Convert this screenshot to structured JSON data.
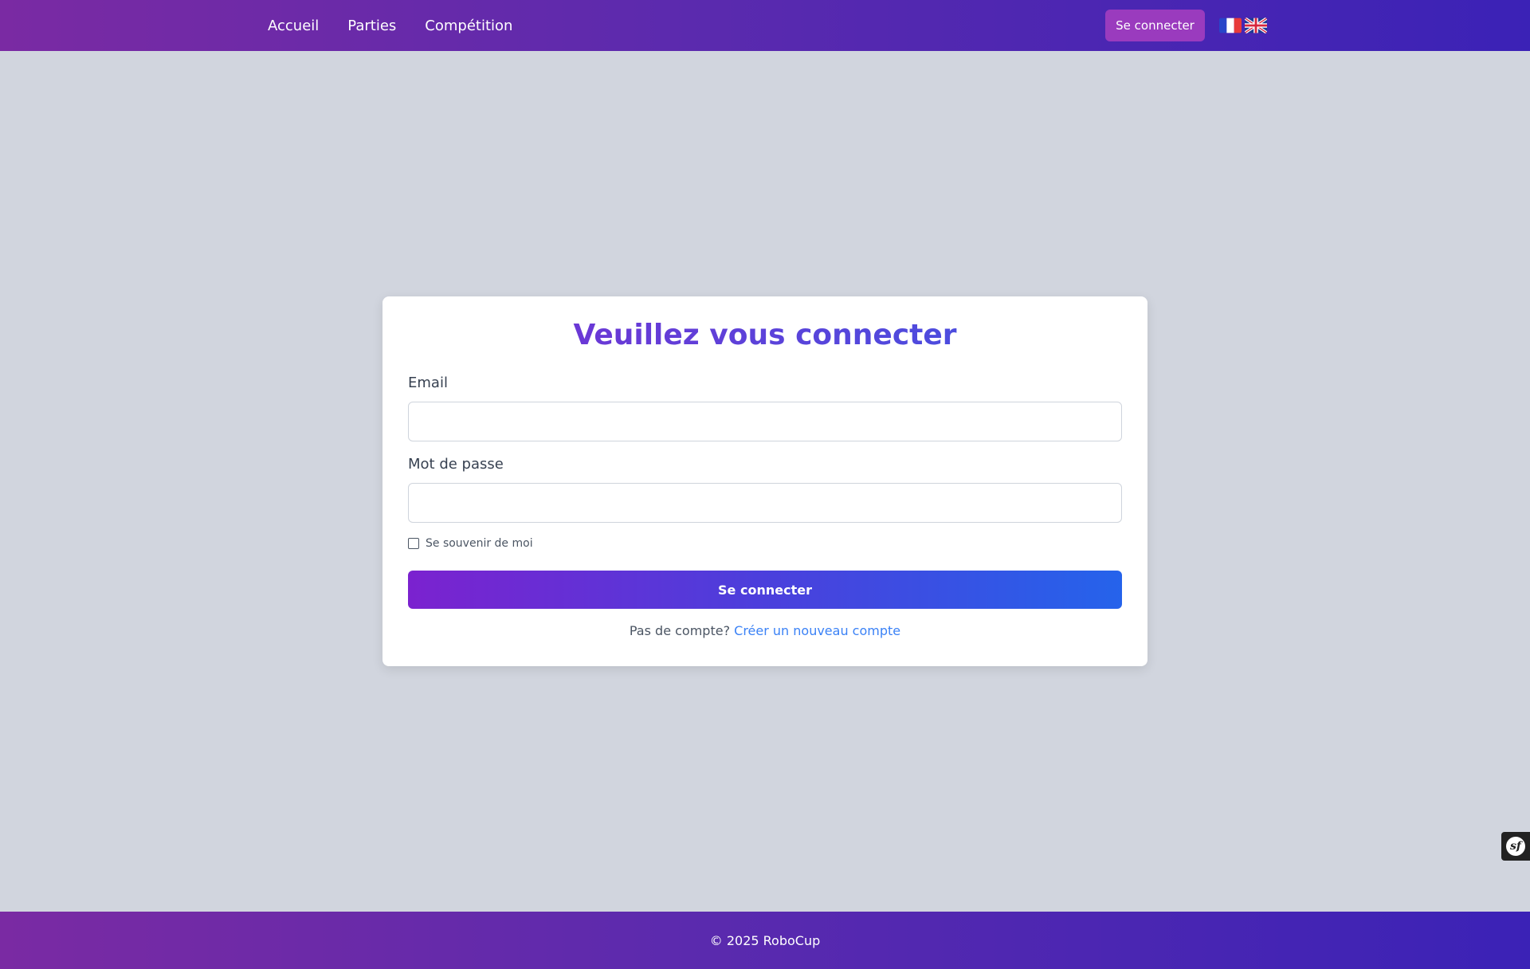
{
  "nav": {
    "items": [
      {
        "label": "Accueil"
      },
      {
        "label": "Parties"
      },
      {
        "label": "Compétition"
      }
    ],
    "login_label": "Se connecter",
    "languages": [
      "fr-flag-icon",
      "uk-flag-icon"
    ]
  },
  "login_form": {
    "title": "Veuillez vous connecter",
    "email_label": "Email",
    "email_value": "",
    "password_label": "Mot de passe",
    "password_value": "",
    "remember_label": "Se souvenir de moi",
    "remember_checked": false,
    "submit_label": "Se connecter",
    "signup_prompt": "Pas de compte?",
    "signup_link": "Créer un nouveau compte"
  },
  "footer": {
    "text": "© 2025 RoboCup"
  },
  "colors": {
    "header_start": "#7a2aa3",
    "header_end": "#3b22b6",
    "page_background": "#d1d5de",
    "link": "#3b82f6",
    "button_start": "#7b22cf",
    "button_end": "#2563eb"
  },
  "icons": {
    "debug_toolbar": "symfony-icon"
  }
}
